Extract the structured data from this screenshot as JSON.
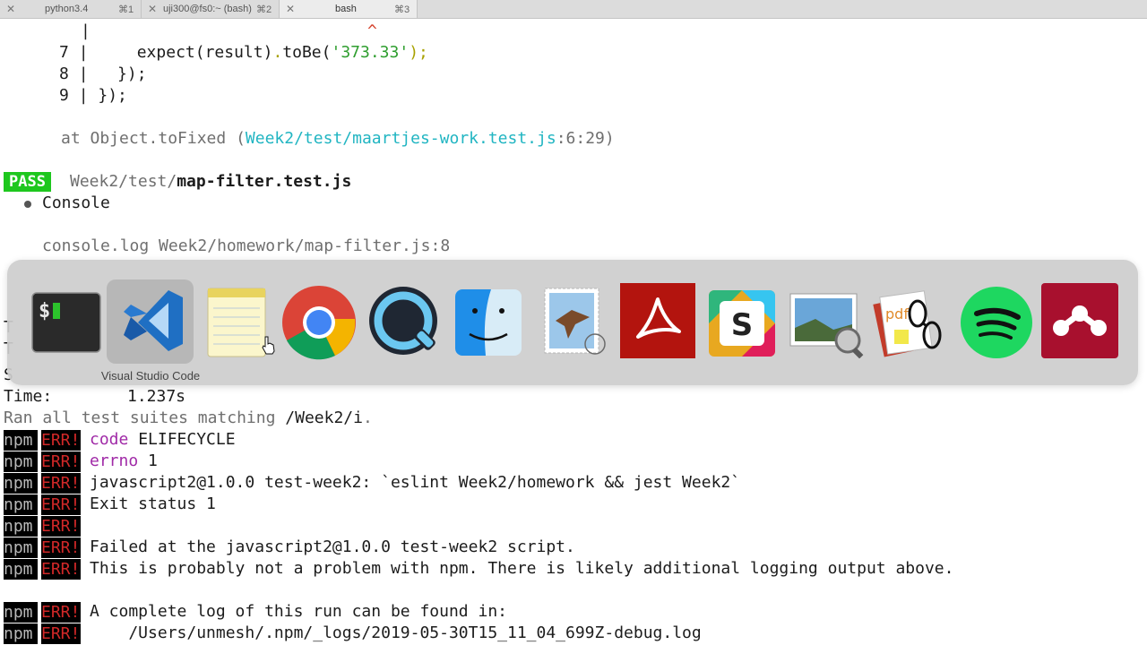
{
  "tabs": [
    {
      "name": "python3.4",
      "shortcut": "⌘1"
    },
    {
      "name": "uji300@fs0:~ (bash)",
      "shortcut": "⌘2"
    },
    {
      "name": "bash",
      "shortcut": "⌘3"
    }
  ],
  "terminal": {
    "caret_line": {
      "bar": "|",
      "caret": "^"
    },
    "code_lines": [
      {
        "num": "7",
        "bar": "|",
        "code_a": "    expect(result)",
        "code_dot": ".",
        "code_b": "toBe(",
        "code_str": "'373.33'",
        "code_c": ");"
      },
      {
        "num": "8",
        "bar": "|",
        "code_a": "  });"
      },
      {
        "num": "9",
        "bar": "|",
        "code_a": "});"
      }
    ],
    "stack_line": {
      "prefix": "at Object.toFixed (",
      "path": "Week2/test/maartjes-work.test.js",
      "loc": ":6:29)"
    },
    "pass": {
      "badge": "PASS",
      "dir": "Week2/test/",
      "file": "map-filter.test.js"
    },
    "console_label": "Console",
    "console_log": "console.log Week2/homework/map-filter.js:8",
    "partial_left": {
      "a": "T",
      "b": "T",
      "c": "S"
    },
    "time": {
      "label": "Time:",
      "value": "1.237s"
    },
    "ran": {
      "text": "Ran all test suites matching ",
      "pattern": "/Week2/i",
      "end": "."
    },
    "npm_tag": "npm",
    "err_tag": "ERR!",
    "npm_lines": [
      {
        "key": "code",
        "value": "ELIFECYCLE"
      },
      {
        "key": "errno",
        "value": "1"
      },
      {
        "key": "",
        "value": "javascript2@1.0.0 test-week2: `eslint Week2/homework && jest Week2`"
      },
      {
        "key": "",
        "value": "Exit status 1"
      },
      {
        "key": "",
        "value": ""
      },
      {
        "key": "",
        "value": "Failed at the javascript2@1.0.0 test-week2 script."
      },
      {
        "key": "",
        "value": "This is probably not a problem with npm. There is likely additional logging output above."
      },
      {
        "key": "",
        "value": "A complete log of this run can be found in:"
      },
      {
        "key": "",
        "value": "    /Users/unmesh/.npm/_logs/2019-05-30T15_11_04_699Z-debug.log"
      }
    ]
  },
  "switcher": {
    "selected_label": "Visual Studio Code",
    "apps": [
      {
        "name": "terminal-icon",
        "glyph": "$"
      },
      {
        "name": "vscode-icon",
        "glyph": ""
      },
      {
        "name": "notes-icon",
        "glyph": ""
      },
      {
        "name": "chrome-icon",
        "glyph": ""
      },
      {
        "name": "quicktime-icon",
        "glyph": ""
      },
      {
        "name": "finder-icon",
        "glyph": ""
      },
      {
        "name": "mail-icon",
        "glyph": ""
      },
      {
        "name": "acrobat-icon",
        "glyph": ""
      },
      {
        "name": "slack-icon",
        "glyph": "S"
      },
      {
        "name": "preview-icon",
        "glyph": ""
      },
      {
        "name": "pdf-reader-icon",
        "glyph": "pdf"
      },
      {
        "name": "spotify-icon",
        "glyph": ""
      },
      {
        "name": "mendeley-icon",
        "glyph": ""
      }
    ]
  }
}
